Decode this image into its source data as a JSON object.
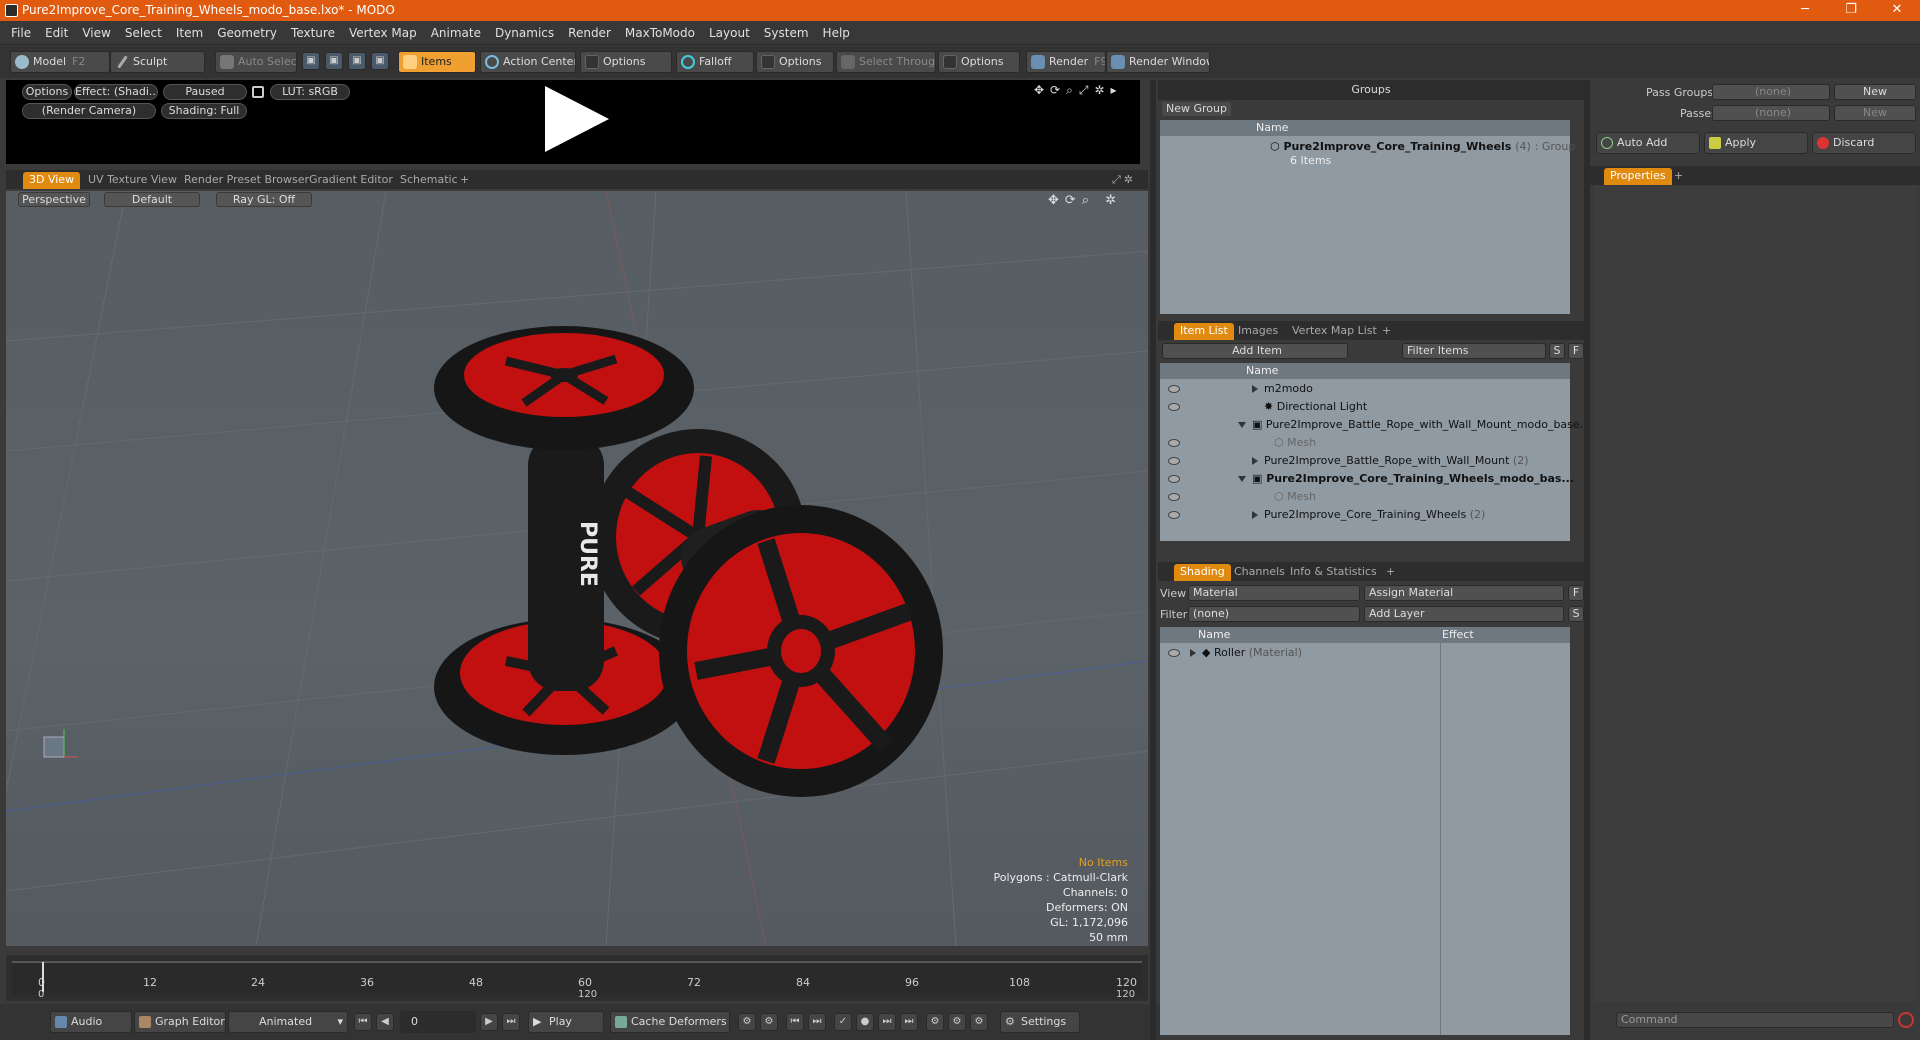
{
  "window": {
    "title": "Pure2Improve_Core_Training_Wheels_modo_base.lxo* - MODO",
    "controls": [
      "─",
      "❐",
      "✕"
    ]
  },
  "menu": [
    "File",
    "Edit",
    "View",
    "Select",
    "Item",
    "Geometry",
    "Texture",
    "Vertex Map",
    "Animate",
    "Dynamics",
    "Render",
    "MaxToModo",
    "Layout",
    "System",
    "Help"
  ],
  "toolbar": {
    "model": "Model",
    "model_key": "F2",
    "sculpt": "Sculpt",
    "auto_select": "Auto Select",
    "items": "Items",
    "action_center": "Action Center",
    "options1": "Options",
    "falloff": "Falloff",
    "options2": "Options",
    "select_through": "Select Through",
    "options3": "Options",
    "render": "Render",
    "render_key": "F9",
    "render_window": "Render Window"
  },
  "preview": {
    "options": "Options",
    "effect": "Effect: (Shadi...",
    "paused": "Paused",
    "lut": "LUT: sRGB",
    "camera": "(Render Camera)",
    "shading": "Shading: Full"
  },
  "viewport_tabs": [
    "3D View",
    "UV Texture View",
    "Render Preset Browser",
    "Gradient Editor",
    "Schematic",
    "+"
  ],
  "viewport": {
    "perspective": "Perspective",
    "default": "Default",
    "raygl": "Ray GL: Off",
    "logo_text": "PURE",
    "stats": {
      "no_items": "No Items",
      "polygons": "Polygons : Catmull-Clark",
      "channels": "Channels: 0",
      "deformers": "Deformers: ON",
      "gl": "GL: 1,172,096",
      "size": "50 mm"
    },
    "accent_color": "#e0a020"
  },
  "timeline": {
    "ticks": [
      "0",
      "12",
      "24",
      "36",
      "48",
      "60",
      "72",
      "84",
      "96",
      "108",
      "120"
    ],
    "lower_left": "0",
    "lower_mid": "120",
    "lower_right": "120"
  },
  "bottombar": {
    "audio": "Audio",
    "graph_editor": "Graph Editor",
    "animated": "Animated",
    "frame": "0",
    "play": "Play",
    "cache_deformers": "Cache Deformers",
    "settings": "Settings"
  },
  "groups": {
    "header": "Groups",
    "new_group": "New Group",
    "col_name": "Name",
    "item_name": "Pure2Improve_Core_Training_Wheels",
    "item_count": "(4)",
    "item_type": ": Group",
    "item_sub": "6 Items"
  },
  "itemlist": {
    "tabs": [
      "Item List",
      "Images",
      "Vertex Map List",
      "+"
    ],
    "add_item": "Add Item",
    "filter": "Filter Items",
    "s": "S",
    "f": "F",
    "col_name": "Name",
    "rows": [
      {
        "label": "m2modo",
        "sub": ""
      },
      {
        "label": "Directional Light",
        "sub": ""
      },
      {
        "label": "Pure2Improve_Battle_Rope_with_Wall_Mount_modo_base...",
        "sub": ""
      },
      {
        "label": "Mesh",
        "sub": ""
      },
      {
        "label": "Pure2Improve_Battle_Rope_with_Wall_Mount",
        "sub": "(2)"
      },
      {
        "label": "Pure2Improve_Core_Training_Wheels_modo_bas...",
        "sub": ""
      },
      {
        "label": "Mesh",
        "sub": ""
      },
      {
        "label": "Pure2Improve_Core_Training_Wheels",
        "sub": "(2)"
      }
    ]
  },
  "shading": {
    "tabs": [
      "Shading",
      "Channels",
      "Info & Statistics",
      "+"
    ],
    "view_label": "View",
    "view_value": "Material",
    "assign_material": "Assign Material",
    "f": "F",
    "filter_label": "Filter",
    "filter_value": "(none)",
    "add_layer": "Add Layer",
    "s": "S",
    "col_name": "Name",
    "col_effect": "Effect",
    "row_name": "Roller",
    "row_sub": "(Material)"
  },
  "rightpanel": {
    "pass_groups": "Pass Groups",
    "pass_groups_value": "(none)",
    "new1": "New",
    "passes": "Passes",
    "passes_value": "(none)",
    "new2": "New",
    "auto_add": "Auto Add",
    "apply": "Apply",
    "discard": "Discard",
    "properties": "Properties",
    "plus": "+",
    "command": "Command"
  }
}
